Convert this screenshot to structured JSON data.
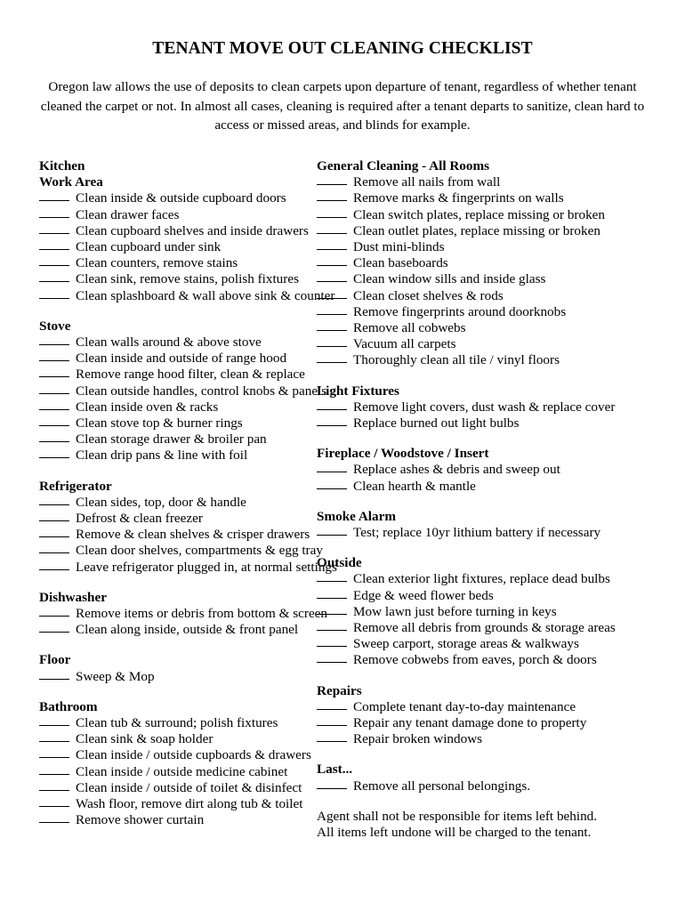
{
  "document": {
    "title": "TENANT MOVE OUT CLEANING CHECKLIST",
    "intro": "Oregon law allows the use of deposits to clean carpets upon departure of tenant, regardless of whether tenant cleaned the carpet or not. In almost all cases, cleaning is required after a tenant departs to sanitize, clean hard to access or missed areas, and blinds for example."
  },
  "left_column": {
    "kitchen": {
      "heading": "Kitchen",
      "subheading": "Work Area",
      "items": [
        "Clean inside & outside cupboard doors",
        "Clean drawer faces",
        "Clean cupboard shelves and inside drawers",
        "Clean cupboard under sink",
        "Clean counters, remove stains",
        "Clean sink, remove stains, polish fixtures",
        "Clean splashboard & wall above sink & counter"
      ]
    },
    "stove": {
      "heading": "Stove",
      "items": [
        "Clean walls around & above stove",
        "Clean inside and outside of range hood",
        "Remove range hood filter, clean & replace",
        "Clean outside handles, control knobs & panels",
        "Clean inside oven & racks",
        "Clean stove top & burner rings",
        "Clean storage drawer & broiler pan",
        "Clean drip pans & line with foil"
      ]
    },
    "refrigerator": {
      "heading": "Refrigerator",
      "items": [
        "Clean sides, top, door & handle",
        "Defrost & clean freezer",
        "Remove & clean shelves & crisper drawers",
        "Clean door shelves, compartments & egg tray",
        "Leave refrigerator plugged in, at normal settings"
      ]
    },
    "dishwasher": {
      "heading": "Dishwasher",
      "items": [
        "Remove items or debris from bottom & screen",
        "Clean along inside, outside & front panel"
      ]
    },
    "floor": {
      "heading": "Floor",
      "items": [
        "Sweep & Mop"
      ]
    },
    "bathroom": {
      "heading": "Bathroom",
      "items": [
        "Clean tub & surround; polish fixtures",
        "Clean sink & soap holder",
        "Clean inside / outside cupboards & drawers",
        "Clean inside / outside medicine cabinet",
        "Clean inside / outside of toilet & disinfect",
        "Wash floor, remove dirt along tub & toilet",
        "Remove shower curtain"
      ]
    }
  },
  "right_column": {
    "general_cleaning": {
      "heading": "General Cleaning - All Rooms",
      "items": [
        "Remove all nails from wall",
        "Remove marks & fingerprints on walls",
        "Clean switch plates, replace missing or broken",
        "Clean outlet plates, replace missing or broken",
        "Dust mini-blinds",
        "Clean baseboards",
        "Clean window sills and inside glass",
        "Clean closet shelves & rods",
        "Remove fingerprints around doorknobs",
        "Remove all cobwebs",
        "Vacuum all carpets",
        "Thoroughly clean all tile / vinyl floors"
      ]
    },
    "light_fixtures": {
      "heading": "Light Fixtures",
      "items": [
        "Remove light covers, dust wash & replace cover",
        "Replace burned out light bulbs"
      ]
    },
    "fireplace": {
      "heading": "Fireplace / Woodstove / Insert",
      "items": [
        "Replace ashes & debris and sweep out",
        "Clean hearth & mantle"
      ]
    },
    "smoke_alarm": {
      "heading": "Smoke Alarm",
      "items": [
        "Test; replace 10yr lithium battery if necessary"
      ]
    },
    "outside": {
      "heading": "Outside",
      "items": [
        "Clean exterior light fixtures, replace dead bulbs",
        "Edge & weed flower beds",
        "Mow lawn just before turning in keys",
        "Remove all debris from grounds & storage areas",
        "Sweep carport, storage areas & walkways",
        "Remove cobwebs from eaves, porch & doors"
      ]
    },
    "repairs": {
      "heading": "Repairs",
      "items": [
        "Complete tenant day-to-day maintenance",
        "Repair any tenant damage done to property",
        "Repair broken windows"
      ]
    },
    "last": {
      "heading": "Last...",
      "items": [
        "Remove all personal belongings."
      ]
    },
    "closing": [
      "Agent shall not be responsible for items left behind.",
      "All items left undone will be charged to the tenant."
    ]
  }
}
